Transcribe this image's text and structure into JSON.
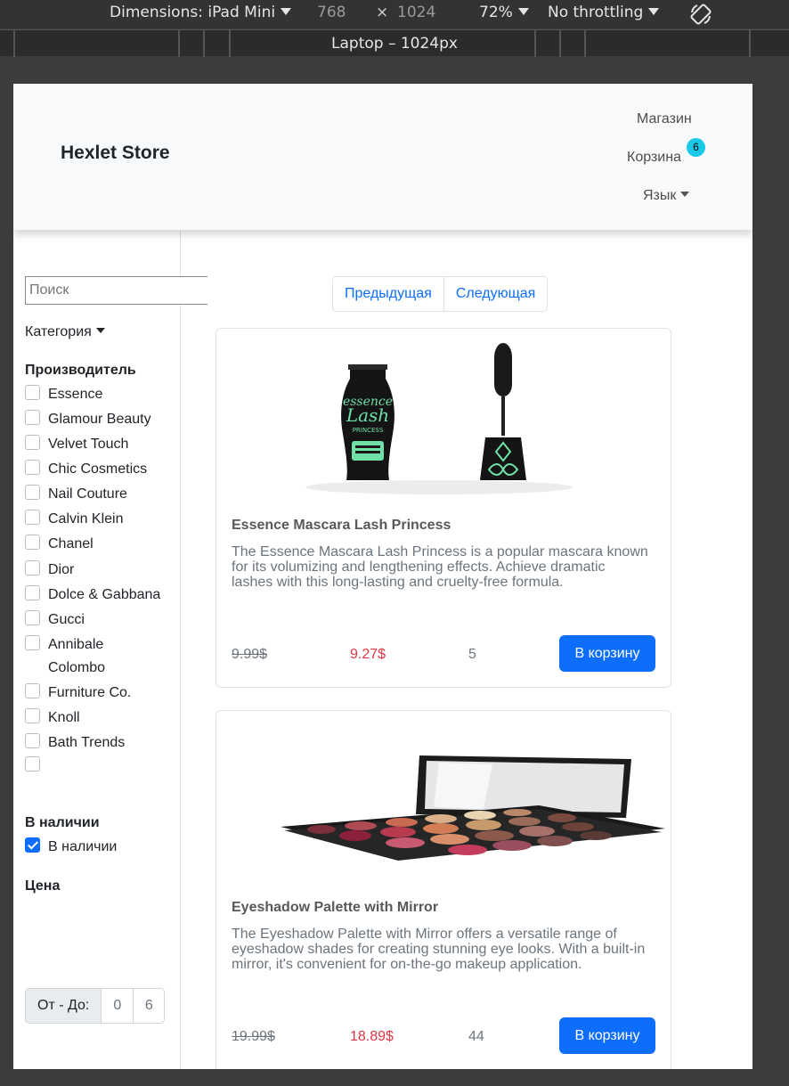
{
  "devtools": {
    "dimensions": "Dimensions: iPad Mini",
    "width": "768",
    "times": "×",
    "height": "1024",
    "zoom": "72%",
    "throttling": "No throttling",
    "media_label": "Laptop – 1024px"
  },
  "navbar": {
    "brand": "Hexlet Store",
    "shop": "Магазин",
    "cart": "Корзина",
    "cart_count": "6",
    "language": "Язык"
  },
  "sidebar": {
    "search_placeholder": "Поиск",
    "category": "Категория",
    "manufacturer_heading": "Производитель",
    "manufacturers": [
      {
        "label": "Essence",
        "checked": false
      },
      {
        "label": "Glamour Beauty",
        "checked": false
      },
      {
        "label": "Velvet Touch",
        "checked": false
      },
      {
        "label": "Chic Cosmetics",
        "checked": false
      },
      {
        "label": "Nail Couture",
        "checked": false
      },
      {
        "label": "Calvin Klein",
        "checked": false
      },
      {
        "label": "Chanel",
        "checked": false
      },
      {
        "label": "Dior",
        "checked": false
      },
      {
        "label": "Dolce & Gabbana",
        "checked": false
      },
      {
        "label": "Gucci",
        "checked": false
      },
      {
        "label": "Annibale",
        "checked": false
      },
      {
        "label": "Colombo",
        "checked": false
      },
      {
        "label": "Furniture Co.",
        "checked": false
      },
      {
        "label": "Knoll",
        "checked": false
      },
      {
        "label": "Bath Trends",
        "checked": false
      },
      {
        "label": "",
        "checked": false
      }
    ],
    "availability_heading": "В наличии",
    "availability_label": "В наличии",
    "availability_checked": true,
    "price_heading": "Цена",
    "price_range_label": "От - До:",
    "price_from": "0",
    "price_to": "6"
  },
  "pagination": {
    "prev": "Предыдущая",
    "next": "Следующая"
  },
  "products": [
    {
      "title": "Essence Mascara Lash Princess",
      "description": "The Essence Mascara Lash Princess is a popular mascara known for its volumizing and lengthening effects. Achieve dramatic lashes with this long-lasting and cruelty-free formula.",
      "old_price": "9.99$",
      "price": "9.27$",
      "stock": "5",
      "button": "В корзину",
      "image": "mascara-image"
    },
    {
      "title": "Eyeshadow Palette with Mirror",
      "description": "The Eyeshadow Palette with Mirror offers a versatile range of eyeshadow shades for creating stunning eye looks. With a built-in mirror, it's convenient for on-the-go makeup application.",
      "old_price": "19.99$",
      "price": "18.89$",
      "stock": "44",
      "button": "В корзину",
      "image": "eyeshadow-palette-image"
    }
  ],
  "colors": {
    "primary": "#0d6efd",
    "danger": "#dc3545",
    "badge": "#1ac8e8",
    "mascara_green": "#6fe0a6"
  }
}
